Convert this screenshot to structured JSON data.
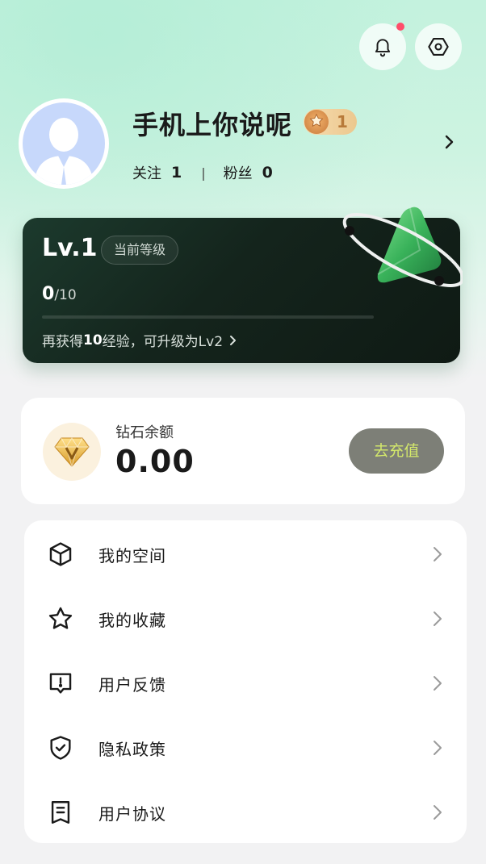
{
  "header": {
    "notification_icon": "bell-icon",
    "settings_icon": "hexagon-settings-icon",
    "has_unread": true
  },
  "profile": {
    "avatar": "default-user-avatar",
    "username": "手机上你说呢",
    "level_badge": "1",
    "follow_label": "关注",
    "follow_count": "1",
    "fans_label": "粉丝",
    "fans_count": "0"
  },
  "level_card": {
    "level": "Lv.1",
    "tag": "当前等级",
    "progress_current": "0",
    "progress_max": "/10",
    "progress_fraction": 0,
    "hint_prefix": "再获得",
    "hint_value": "10",
    "hint_suffix": " 经验，可升级为Lv2"
  },
  "wallet": {
    "label": "钻石余额",
    "amount": "0.00",
    "recharge_label": "去充值"
  },
  "menu": {
    "items": [
      {
        "label": "我的空间",
        "icon": "cube-icon"
      },
      {
        "label": "我的收藏",
        "icon": "star-icon"
      },
      {
        "label": "用户反馈",
        "icon": "feedback-icon"
      },
      {
        "label": "隐私政策",
        "icon": "shield-check-icon"
      },
      {
        "label": "用户协议",
        "icon": "document-icon"
      }
    ]
  },
  "colors": {
    "accent_green": "#6ee0a8",
    "recharge_text": "#d4e96b",
    "recharge_bg": "#7d7f77",
    "notification_dot": "#ff4d6a"
  }
}
